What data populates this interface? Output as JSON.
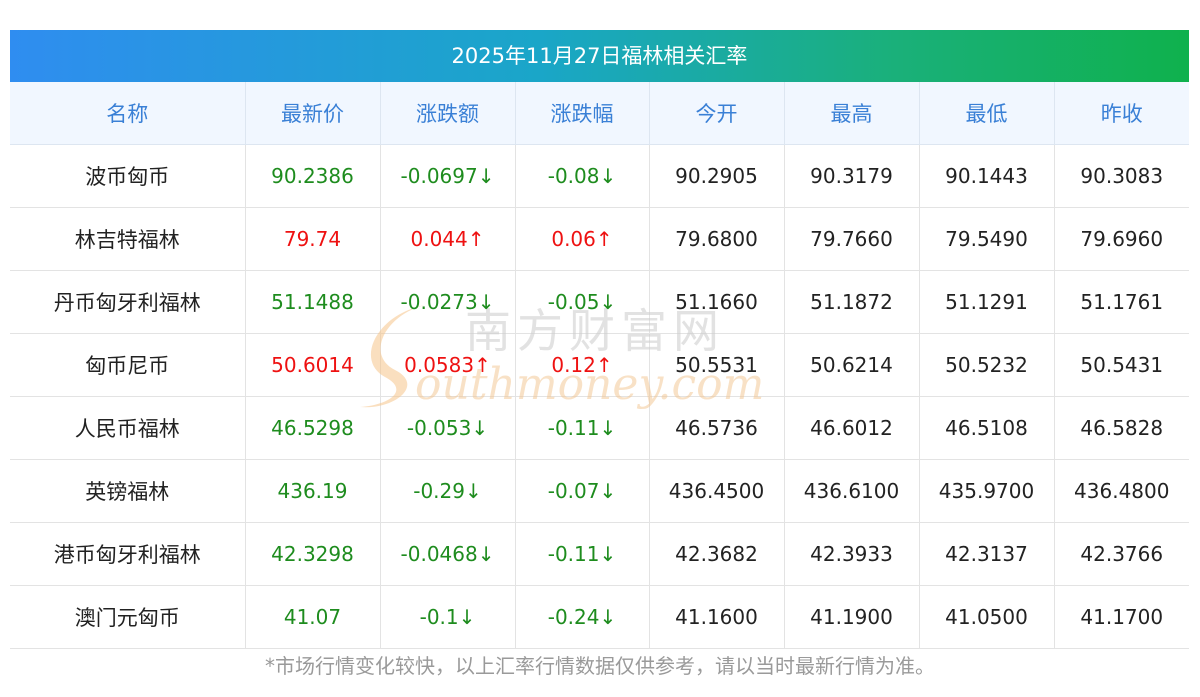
{
  "title": "2025年11月27日福林相关汇率",
  "columns": [
    "名称",
    "最新价",
    "涨跌额",
    "涨跌幅",
    "今开",
    "最高",
    "最低",
    "昨收"
  ],
  "rows": [
    {
      "name": "波币匈币",
      "latest": "90.2386",
      "change": "-0.0697↓",
      "pct": "-0.08↓",
      "open": "90.2905",
      "high": "90.3179",
      "low": "90.1443",
      "prev": "90.3083",
      "dir": "down"
    },
    {
      "name": "林吉特福林",
      "latest": "79.74",
      "change": "0.044↑",
      "pct": "0.06↑",
      "open": "79.6800",
      "high": "79.7660",
      "low": "79.5490",
      "prev": "79.6960",
      "dir": "up"
    },
    {
      "name": "丹币匈牙利福林",
      "latest": "51.1488",
      "change": "-0.0273↓",
      "pct": "-0.05↓",
      "open": "51.1660",
      "high": "51.1872",
      "low": "51.1291",
      "prev": "51.1761",
      "dir": "down"
    },
    {
      "name": "匈币尼币",
      "latest": "50.6014",
      "change": "0.0583↑",
      "pct": "0.12↑",
      "open": "50.5531",
      "high": "50.6214",
      "low": "50.5232",
      "prev": "50.5431",
      "dir": "up"
    },
    {
      "name": "人民币福林",
      "latest": "46.5298",
      "change": "-0.053↓",
      "pct": "-0.11↓",
      "open": "46.5736",
      "high": "46.6012",
      "low": "46.5108",
      "prev": "46.5828",
      "dir": "down"
    },
    {
      "name": "英镑福林",
      "latest": "436.19",
      "change": "-0.29↓",
      "pct": "-0.07↓",
      "open": "436.4500",
      "high": "436.6100",
      "low": "435.9700",
      "prev": "436.4800",
      "dir": "down"
    },
    {
      "name": "港币匈牙利福林",
      "latest": "42.3298",
      "change": "-0.0468↓",
      "pct": "-0.11↓",
      "open": "42.3682",
      "high": "42.3933",
      "low": "42.3137",
      "prev": "42.3766",
      "dir": "down"
    },
    {
      "name": "澳门元匈币",
      "latest": "41.07",
      "change": "-0.1↓",
      "pct": "-0.24↓",
      "open": "41.1600",
      "high": "41.1900",
      "low": "41.0500",
      "prev": "41.1700",
      "dir": "down"
    }
  ],
  "watermark": {
    "cn": "南方财富网",
    "en": "outhmoney.com"
  },
  "note": "*市场行情变化较快，以上汇率行情数据仅供参考，请以当时最新行情为准。",
  "colors": {
    "up": "#ee1111",
    "down": "#1e8c1e",
    "header_text": "#3a80d6"
  }
}
